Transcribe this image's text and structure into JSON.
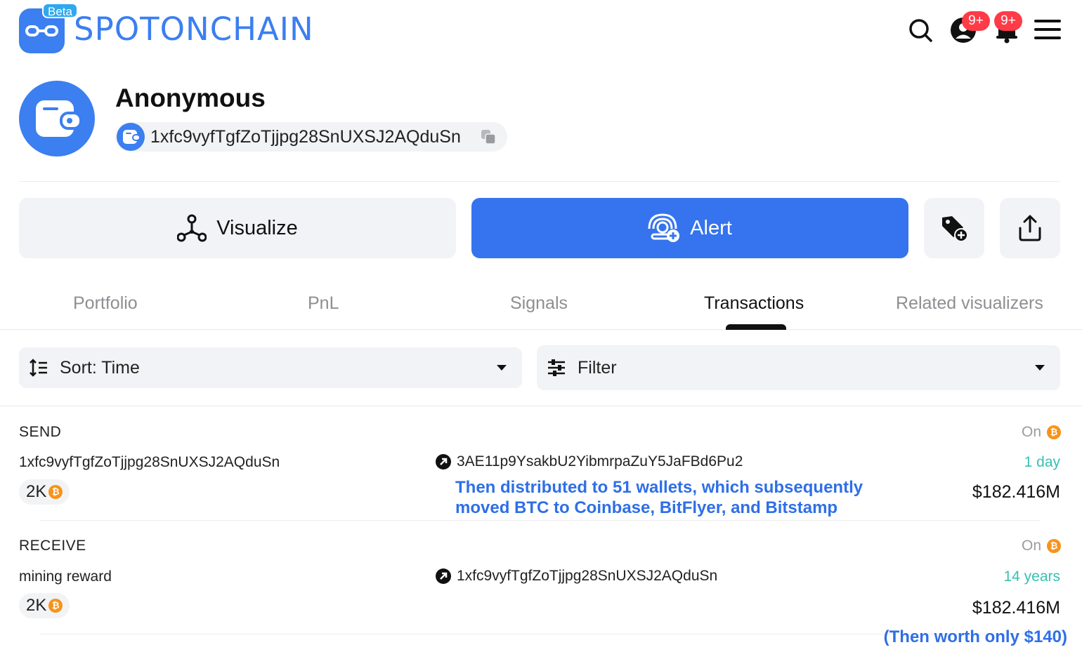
{
  "header": {
    "beta": "Beta",
    "brand": "SPOTONCHAIN",
    "badge_account": "9+",
    "badge_notifications": "9+"
  },
  "profile": {
    "name": "Anonymous",
    "address": "1xfc9vyfTgfZoTjjpg28SnUXSJ2AQduSn"
  },
  "actions": {
    "visualize": "Visualize",
    "alert": "Alert"
  },
  "tabs": [
    {
      "label": "Portfolio",
      "active": false
    },
    {
      "label": "PnL",
      "active": false
    },
    {
      "label": "Signals",
      "active": false
    },
    {
      "label": "Transactions",
      "active": true
    },
    {
      "label": "Related visualizers",
      "active": false
    }
  ],
  "controls": {
    "sort": "Sort: Time",
    "filter": "Filter"
  },
  "transactions": [
    {
      "type": "SEND",
      "from": "1xfc9vyfTgfZoTjjpg28SnUXSJ2AQduSn",
      "to": "3AE11p9YsakbU2YibmrpaZuY5JaFBd6Pu2",
      "amount": "2K",
      "on": "On",
      "age": "1 day",
      "value": "$182.416M",
      "annotation": "Then distributed to 51 wallets, which subsequently moved BTC to Coinbase, BitFlyer, and Bitstamp"
    },
    {
      "type": "RECEIVE",
      "from": "mining reward",
      "to": "1xfc9vyfTgfZoTjjpg28SnUXSJ2AQduSn",
      "amount": "2K",
      "on": "On",
      "age": "14 years",
      "value": "$182.416M",
      "annotation": "(Then worth only $140)"
    }
  ],
  "icons": {
    "bitcoin": "₿"
  },
  "colors": {
    "brand": "#3b7ff0",
    "alert_button": "#3574ee",
    "age_text": "#35c2b3",
    "annotation": "#2f6fe6",
    "badge": "#ff3b47",
    "bitcoin": "#f7931a"
  }
}
